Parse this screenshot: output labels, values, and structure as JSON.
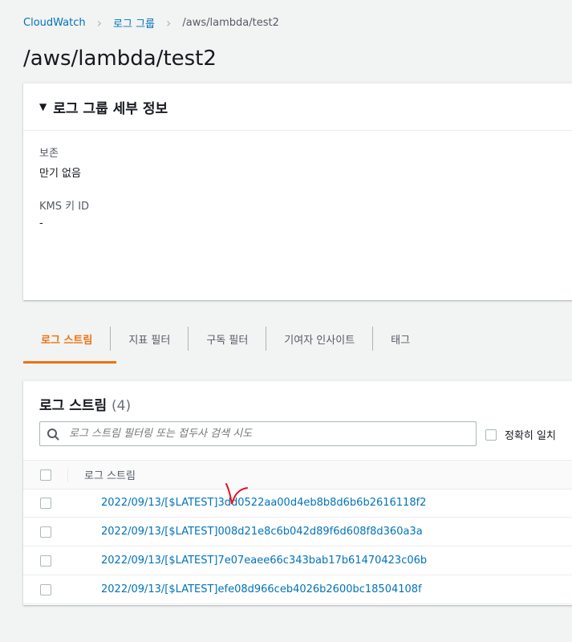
{
  "breadcrumb": [
    "CloudWatch",
    "로그 그룹",
    "/aws/lambda/test2"
  ],
  "page_title": "/aws/lambda/test2",
  "details": {
    "header": "로그 그룹 세부 정보",
    "retention_label": "보존",
    "retention_value": "만기 없음",
    "kms_label": "KMS 키 ID",
    "kms_value": "-"
  },
  "tabs": [
    "로그 스트림",
    "지표 필터",
    "구독 필터",
    "기여자 인사이트",
    "태그"
  ],
  "streams": {
    "title": "로그 스트림",
    "count": "(4)",
    "search_placeholder": "로그 스트림 필터링 또는 접두사 검색 시도",
    "exact_match": "정확히 일치",
    "column": "로그 스트림",
    "rows": [
      "2022/09/13/[$LATEST]3dd0522aa00d4eb8b8d6b6b2616118f2",
      "2022/09/13/[$LATEST]008d21e8c6b042d89f6d608f8d360a3a",
      "2022/09/13/[$LATEST]7e07eaee66c343bab17b61470423c06b",
      "2022/09/13/[$LATEST]efe08d966ceb4026b2600bc18504108f"
    ]
  },
  "colors": {
    "link": "#0073bb",
    "accent": "#ec7211",
    "annotation": "#e0141e"
  }
}
